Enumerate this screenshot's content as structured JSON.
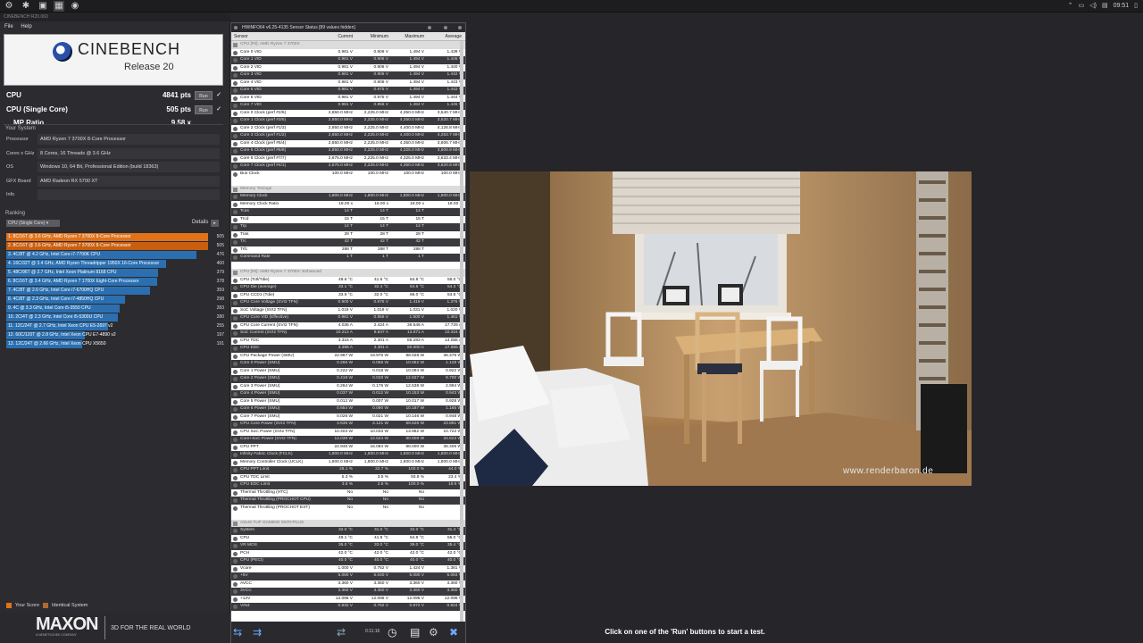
{
  "taskbar": {
    "time": "09:51"
  },
  "cinebench": {
    "window_title": "CINEBENCH R20.060",
    "menu": [
      "File",
      "Help"
    ],
    "logo_name": "CINEBENCH",
    "logo_release": "Release 20",
    "cpu_label": "CPU",
    "cpu_score": "4841 pts",
    "cpu_single_label": "CPU (Single Core)",
    "cpu_single_score": "505 pts",
    "mp_label": "MP Ratio",
    "mp_value": "9.58 x",
    "run_label": "Run",
    "your_system_label": "Your System",
    "system": [
      {
        "k": "Processor",
        "v": "AMD Ryzen 7 3700X 8-Core Processor"
      },
      {
        "k": "Cores x GHz",
        "v": "8 Cores, 16 Threads @ 3.6 GHz"
      },
      {
        "k": "OS",
        "v": "Windows 10, 64 Bit, Professional Edition (build 18363)"
      },
      {
        "k": "GFX Board",
        "v": "AMD Radeon RX 5700 XT"
      },
      {
        "k": "Info",
        "v": ""
      }
    ],
    "ranking_label": "Ranking",
    "ranking_dropdown": "CPU (Single Core)",
    "details_label": "Details",
    "ranking": [
      {
        "label": "1. 8C/16T @ 3.6 GHz, AMD Ryzen 7 3700X 8-Core Processor",
        "score": 505,
        "color": "#e0721a"
      },
      {
        "label": "2. 8C/16T @ 3.6 GHz, AMD Ryzen 7 3700X 8-Core Processor",
        "score": 505,
        "color": "#c85f10"
      },
      {
        "label": "3. 4C/8T @ 4.2 GHz, Intel Core i7-7700K CPU",
        "score": 476,
        "color": "#2b6fb0"
      },
      {
        "label": "4. 16C/32T @ 3.4 GHz, AMD Ryzen Threadripper 1950X 16-Core Processor",
        "score": 400,
        "color": "#2b6fb0"
      },
      {
        "label": "5. 48C/96T @ 2.7 GHz, Intel Xeon Platinum 8168 CPU",
        "score": 379,
        "color": "#2b6fb0"
      },
      {
        "label": "6. 8C/16T @ 3.4 GHz, AMD Ryzen 7 1700X Eight-Core Processor",
        "score": 378,
        "color": "#2b6fb0"
      },
      {
        "label": "7. 4C/8T @ 2.6 GHz, Intel Core i7-6700HQ CPU",
        "score": 359,
        "color": "#2b6fb0"
      },
      {
        "label": "8. 4C/8T @ 2.3 GHz, Intel Core i7-4850HQ CPU",
        "score": 298,
        "color": "#2b6fb0"
      },
      {
        "label": "9. 4C @ 3.3 GHz, Intel Core i5-3550 CPU",
        "score": 283,
        "color": "#2b6fb0"
      },
      {
        "label": "10. 2C/4T @ 2.3 GHz, Intel Core i5-5300U CPU",
        "score": 280,
        "color": "#2b6fb0"
      },
      {
        "label": "11. 12C/24T @ 2.7 GHz, Intel Xeon CPU E5-2697 v2",
        "score": 255,
        "color": "#2b6fb0"
      },
      {
        "label": "12. 60C/120T @ 2.8 GHz, Intel Xeon CPU E7-4890 v2",
        "score": 197,
        "color": "#2b6fb0"
      },
      {
        "label": "13. 12C/24T @ 2.66 GHz, Intel Xeon CPU X5650",
        "score": 191,
        "color": "#2b6fb0"
      }
    ],
    "legend_your": "Your Score",
    "legend_identical": "Identical System",
    "maxon": "MAXON",
    "maxon_sub": "A NEMETSCHEK COMPANY",
    "maxon_tag": "3D FOR THE REAL WORLD"
  },
  "hwinfo": {
    "title": "HWiNFO64 v6.25-4135 Sensor Status [89 values hidden]",
    "headers": [
      "Sensor",
      "Current",
      "Minimum",
      "Maximum",
      "Average"
    ],
    "rows": [
      [
        "CPU [#0]: AMD Ryzen 7 3700X",
        "",
        "",
        "",
        "",
        "grp"
      ],
      [
        "Core 0 VID",
        "0.981 V",
        "0.906 V",
        "1.494 V",
        "1.439 V",
        ""
      ],
      [
        "Core 1 VID",
        "0.981 V",
        "0.906 V",
        "1.494 V",
        "1.445 V",
        ""
      ],
      [
        "Core 2 VID",
        "0.981 V",
        "0.906 V",
        "1.494 V",
        "1.440 V",
        ""
      ],
      [
        "Core 3 VID",
        "0.981 V",
        "0.906 V",
        "1.494 V",
        "1.442 V",
        ""
      ],
      [
        "Core 4 VID",
        "0.981 V",
        "0.906 V",
        "1.494 V",
        "1.443 V",
        ""
      ],
      [
        "Core 5 VID",
        "0.981 V",
        "0.975 V",
        "1.494 V",
        "1.442 V",
        ""
      ],
      [
        "Core 6 VID",
        "0.981 V",
        "0.975 V",
        "1.494 V",
        "1.444 V",
        ""
      ],
      [
        "Core 7 VID",
        "0.981 V",
        "0.956 V",
        "1.494 V",
        "1.445 V",
        ""
      ],
      [
        "Core 0 Clock (perf #2/6)",
        "2,850.0 MHz",
        "2,225.0 MHz",
        "4,350.0 MHz",
        "3,540.7 MHz",
        ""
      ],
      [
        "Core 1 Clock (perf #3/5)",
        "2,850.0 MHz",
        "2,225.0 MHz",
        "4,350.0 MHz",
        "3,520.7 MHz",
        ""
      ],
      [
        "Core 2 Clock (perf #1/3)",
        "2,850.0 MHz",
        "2,225.0 MHz",
        "4,400.0 MHz",
        "4,126.8 MHz",
        ""
      ],
      [
        "Core 3 Clock (perf #1/2)",
        "2,850.0 MHz",
        "2,225.0 MHz",
        "4,400.0 MHz",
        "4,263.7 MHz",
        ""
      ],
      [
        "Core 4 Clock (perf #5/4)",
        "2,850.0 MHz",
        "2,225.0 MHz",
        "4,350.0 MHz",
        "3,606.7 MHz",
        ""
      ],
      [
        "Core 5 Clock (perf #6/8)",
        "2,850.0 MHz",
        "2,225.0 MHz",
        "4,325.0 MHz",
        "3,606.9 MHz",
        ""
      ],
      [
        "Core 6 Clock (perf #7/7)",
        "2,675.0 MHz",
        "2,225.0 MHz",
        "4,325.0 MHz",
        "3,633.4 MHz",
        ""
      ],
      [
        "Core 7 Clock (perf #4/1)",
        "2,675.0 MHz",
        "2,225.0 MHz",
        "4,350.0 MHz",
        "3,620.9 MHz",
        ""
      ],
      [
        "Bus Clock",
        "100.0 MHz",
        "100.0 MHz",
        "100.0 MHz",
        "100.0 MHz",
        ""
      ],
      [
        "",
        "",
        "",
        "",
        "",
        "blank"
      ],
      [
        "Memory Timings",
        "",
        "",
        "",
        "",
        "grp"
      ],
      [
        "Memory Clock",
        "1,800.0 MHz",
        "1,800.0 MHz",
        "1,800.0 MHz",
        "1,800.0 MHz",
        ""
      ],
      [
        "Memory Clock Ratio",
        "18.00 x",
        "18.00 x",
        "18.00 x",
        "18.00 x",
        ""
      ],
      [
        "Tcas",
        "14 T",
        "14 T",
        "14 T",
        "",
        ""
      ],
      [
        "Trcd",
        "15 T",
        "15 T",
        "15 T",
        "",
        ""
      ],
      [
        "Trp",
        "14 T",
        "14 T",
        "14 T",
        "",
        ""
      ],
      [
        "Tras",
        "28 T",
        "28 T",
        "28 T",
        "",
        ""
      ],
      [
        "Trc",
        "42 T",
        "42 T",
        "42 T",
        "",
        ""
      ],
      [
        "Trfc",
        "288 T",
        "288 T",
        "288 T",
        "",
        ""
      ],
      [
        "Command Rate",
        "1 T",
        "1 T",
        "1 T",
        "",
        ""
      ],
      [
        "",
        "",
        "",
        "",
        "",
        "blank"
      ],
      [
        "CPU [#0]: AMD Ryzen 7 3700X: Enhanced",
        "",
        "",
        "",
        "",
        "grp"
      ],
      [
        "CPU (Tctl/Tdie)",
        "49.6 °C",
        "41.6 °C",
        "64.8 °C",
        "55.0 °C",
        ""
      ],
      [
        "CPU Die (average)",
        "33.1 °C",
        "32.4 °C",
        "64.8 °C",
        "54.3 °C",
        ""
      ],
      [
        "CPU CCD1 (Tdie)",
        "33.6 °C",
        "32.0 °C",
        "66.0 °C",
        "53.8 °C",
        ""
      ],
      [
        "CPU Core Voltage (SVI2 TFN)",
        "0.900 V",
        "0.875 V",
        "1.419 V",
        "1.376 V",
        ""
      ],
      [
        "SoC Voltage (SVI2 TFN)",
        "1.019 V",
        "1.019 V",
        "1.031 V",
        "1.020 V",
        ""
      ],
      [
        "CPU Core VID (Effective)",
        "0.981 V",
        "0.956 V",
        "1.500 V",
        "1.461 V",
        ""
      ],
      [
        "CPU Core Current (SVI2 TFN)",
        "4.036 A",
        "2.424 A",
        "36.546 A",
        "17.729 A",
        ""
      ],
      [
        "SoC Current (SVI2 TFN)",
        "10.212 A",
        "9.847 A",
        "13.871 A",
        "10.324 A",
        ""
      ],
      [
        "CPU TDC",
        "3.316 A",
        "2.301 A",
        "86.283 A",
        "14.058 A",
        ""
      ],
      [
        "CPU EDC",
        "3.398 A",
        "2.301 A",
        "90.000 A",
        "17.655 A",
        ""
      ],
      [
        "CPU Package Power (SMU)",
        "22.967 W",
        "19.976 W",
        "88.028 W",
        "36.476 W",
        ""
      ],
      [
        "Core 0 Power (SMU)",
        "0.266 W",
        "0.056 W",
        "10.062 W",
        "1.128 W",
        ""
      ],
      [
        "Core 1 Power (SMU)",
        "0.222 W",
        "0.018 W",
        "10.094 W",
        "0.922 W",
        ""
      ],
      [
        "Core 2 Power (SMU)",
        "0.419 W",
        "0.028 W",
        "12.627 W",
        "9.700 W",
        ""
      ],
      [
        "Core 3 Power (SMU)",
        "0.264 W",
        "0.176 W",
        "12.538 W",
        "2.994 W",
        ""
      ],
      [
        "Core 4 Power (SMU)",
        "0.037 W",
        "0.012 W",
        "10.153 W",
        "0.943 W",
        ""
      ],
      [
        "Core 5 Power (SMU)",
        "0.012 W",
        "0.007 W",
        "10.017 W",
        "0.928 W",
        ""
      ],
      [
        "Core 6 Power (SMU)",
        "0.654 W",
        "0.090 W",
        "10.187 W",
        "1.165 W",
        ""
      ],
      [
        "Core 7 Power (SMU)",
        "0.026 W",
        "0.021 W",
        "10.146 W",
        "0.948 W",
        ""
      ],
      [
        "CPU Core Power (SVI2 TFN)",
        "3.635 W",
        "2.121 W",
        "69.626 W",
        "23.891 W",
        ""
      ],
      [
        "CPU SoC Power (SVI2 TFN)",
        "10.403 W",
        "10.033 W",
        "13.962 W",
        "10.722 W",
        ""
      ],
      [
        "Core+SoC Power (SVI2 TFN)",
        "14.039 W",
        "12.524 W",
        "80.508 W",
        "34.623 W",
        ""
      ],
      [
        "CPU PPT",
        "22.946 W",
        "16.084 W",
        "88.000 W",
        "36.406 W",
        ""
      ],
      [
        "Infinity Fabric Clock (FCLK)",
        "1,800.0 MHz",
        "1,800.0 MHz",
        "1,800.0 MHz",
        "1,800.0 MHz",
        ""
      ],
      [
        "Memory Controller Clock (UCLK)",
        "1,800.0 MHz",
        "1,800.0 MHz",
        "1,800.0 MHz",
        "1,800.0 MHz",
        ""
      ],
      [
        "CPU PPT Limit",
        "26.1 %",
        "22.7 %",
        "100.0 %",
        "44.0 %",
        ""
      ],
      [
        "CPU TDC Limit",
        "5.3 %",
        "3.5 %",
        "93.8 %",
        "23.4 %",
        ""
      ],
      [
        "CPU EDC Limit",
        "3.8 %",
        "2.5 %",
        "100.0 %",
        "19.6 %",
        ""
      ],
      [
        "Thermal Throttling (HTC)",
        "No",
        "No",
        "No",
        "",
        ""
      ],
      [
        "Thermal Throttling (PROCHOT CPU)",
        "No",
        "No",
        "No",
        "",
        ""
      ],
      [
        "Thermal Throttling (PROCHOT EXT)",
        "No",
        "No",
        "No",
        "",
        ""
      ],
      [
        "",
        "",
        "",
        "",
        "",
        "blank"
      ],
      [
        "ASUS TUF GAMING X570-PLUS",
        "",
        "",
        "",
        "",
        "grp"
      ],
      [
        "System",
        "32.0 °C",
        "31.0 °C",
        "32.0 °C",
        "31.4 °C",
        ""
      ],
      [
        "CPU",
        "49.1 °C",
        "41.8 °C",
        "64.8 °C",
        "55.0 °C",
        ""
      ],
      [
        "VR MOS",
        "35.0 °C",
        "33.0 °C",
        "39.0 °C",
        "35.4 °C",
        ""
      ],
      [
        "PCH",
        "42.0 °C",
        "42.0 °C",
        "42.0 °C",
        "42.0 °C",
        ""
      ],
      [
        "CPU (PECI)",
        "40.0 °C",
        "40.0 °C",
        "40.0 °C",
        "40.0 °C",
        ""
      ],
      [
        "Vcore",
        "1.000 V",
        "0.752 V",
        "1.424 V",
        "1.381 V",
        ""
      ],
      [
        "+5V",
        "5.080 V",
        "5.040 V",
        "5.080 V",
        "5.063 V",
        ""
      ],
      [
        "AVCC",
        "3.360 V",
        "3.360 V",
        "3.360 V",
        "3.360 V",
        ""
      ],
      [
        "3VCC",
        "3.360 V",
        "3.360 V",
        "3.360 V",
        "3.360 V",
        ""
      ],
      [
        "+12V",
        "12.096 V",
        "12.096 V",
        "12.096 V",
        "12.096 V",
        ""
      ],
      [
        "VIN4",
        "0.832 V",
        "0.752 V",
        "0.872 V",
        "0.824 V",
        ""
      ]
    ],
    "elapsed": "0:11:16"
  },
  "render": {
    "watermark": "www.renderbaron.de"
  },
  "status": "Click on one of the 'Run' buttons to start a test."
}
